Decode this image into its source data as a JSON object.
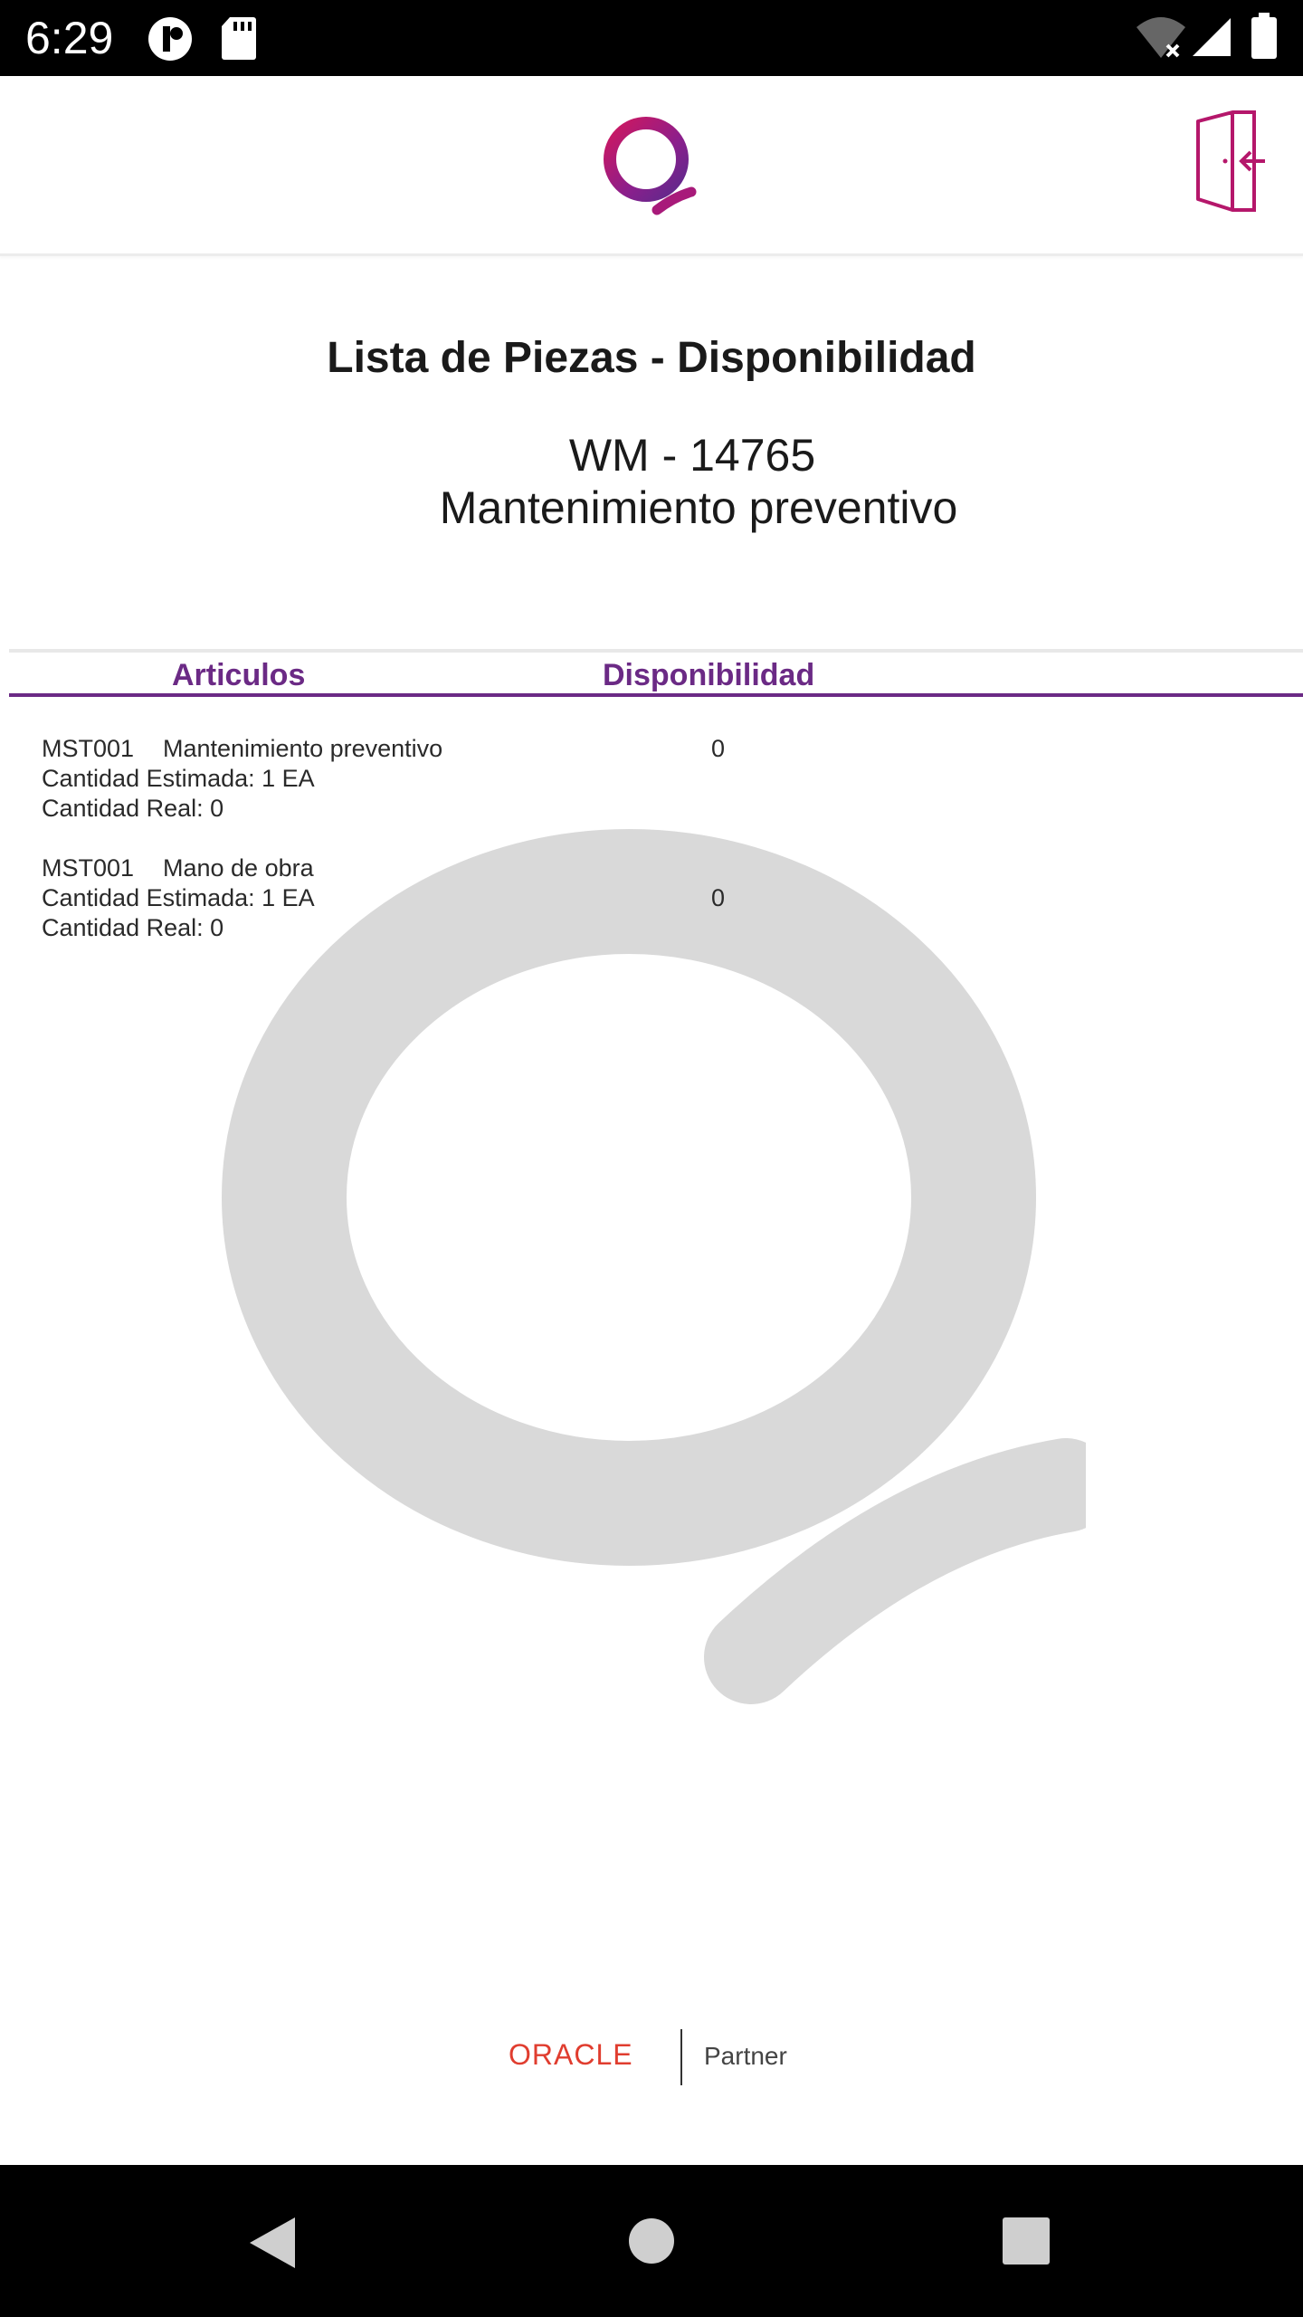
{
  "status_bar": {
    "time": "6:29",
    "icons": [
      "notification-app-icon",
      "sd-card-icon",
      "wifi-off-icon",
      "signal-icon",
      "battery-icon"
    ]
  },
  "header": {
    "logo_icon": "brand-q-logo",
    "logout_icon": "logout-door-icon"
  },
  "page": {
    "title": "Lista de Piezas - Disponibilidad",
    "work_order": "WM - 14765",
    "work_order_description": "Mantenimiento preventivo"
  },
  "table": {
    "headers": {
      "articulos": "Articulos",
      "disponibilidad": "Disponibilidad"
    },
    "rows": [
      {
        "code": "MST001",
        "description": "Mantenimiento preventivo",
        "estimated": "Cantidad Estimada: 1 EA",
        "real": "Cantidad Real: 0",
        "availability": "0"
      },
      {
        "code": "MST001",
        "description": "Mano de obra",
        "estimated": "Cantidad Estimada: 1 EA",
        "real": "Cantidad Real: 0",
        "availability": "0"
      }
    ]
  },
  "footer": {
    "oracle": "ORACLE",
    "partner": "Partner"
  },
  "nav_bar": {
    "icons": [
      "back-icon",
      "home-icon",
      "recents-icon"
    ]
  },
  "colors": {
    "accent_purple": "#6b2a85",
    "brand_magenta": "#b5176b",
    "oracle_red": "#e03d2f",
    "watermark_gray": "#d9d9d9"
  }
}
